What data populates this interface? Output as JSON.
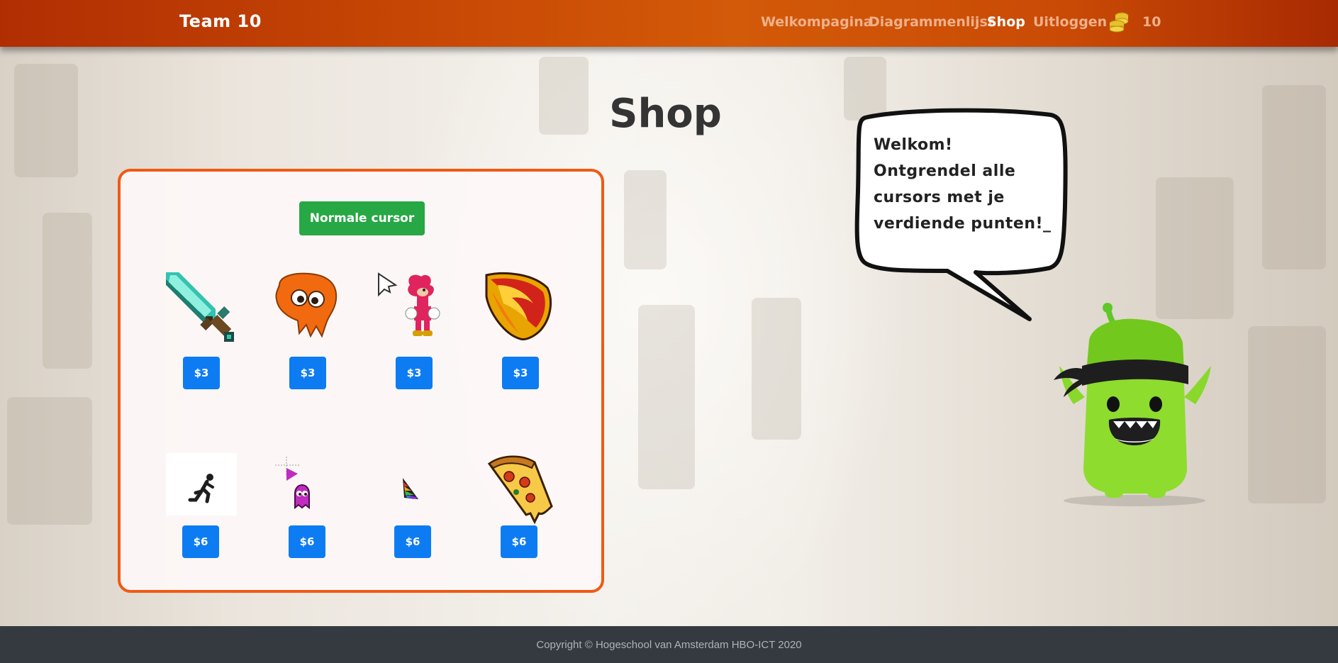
{
  "navbar": {
    "brand": "Team 10",
    "links": [
      {
        "label": "Welkompagina",
        "active": false
      },
      {
        "label": "Diagrammenlijst",
        "active": false
      },
      {
        "label": "Shop",
        "active": true
      },
      {
        "label": "Uitloggen",
        "active": false
      }
    ],
    "coins_icon": "coins-icon",
    "coins": "10"
  },
  "page": {
    "title": "Shop"
  },
  "shop": {
    "normal_cursor_label": "Normale cursor",
    "items": [
      {
        "icon": "diamond-sword-icon",
        "price": "$3"
      },
      {
        "icon": "orange-squid-icon",
        "price": "$3"
      },
      {
        "icon": "knuckles-icon",
        "price": "$3"
      },
      {
        "icon": "fire-shield-icon",
        "price": "$3"
      },
      {
        "icon": "running-man-icon",
        "price": "$6"
      },
      {
        "icon": "pink-ghost-icon",
        "price": "$6"
      },
      {
        "icon": "rainbow-cursor-icon",
        "price": "$6"
      },
      {
        "icon": "pizza-slice-icon",
        "price": "$6"
      }
    ]
  },
  "speech_bubble": {
    "lines": [
      "Welkom!",
      "Ontgrendel alle",
      "cursors met je",
      "verdiende punten!_"
    ]
  },
  "mascot": "green-monster-mascot",
  "footer": {
    "copyright": "Copyright © Hogeschool van Amsterdam HBO-ICT 2020"
  },
  "colors": {
    "navbar": "#c94a05",
    "panel_border": "#f05a14",
    "price_button": "#0d7cf2",
    "normal_button": "#28a745",
    "footer": "#343a40"
  }
}
